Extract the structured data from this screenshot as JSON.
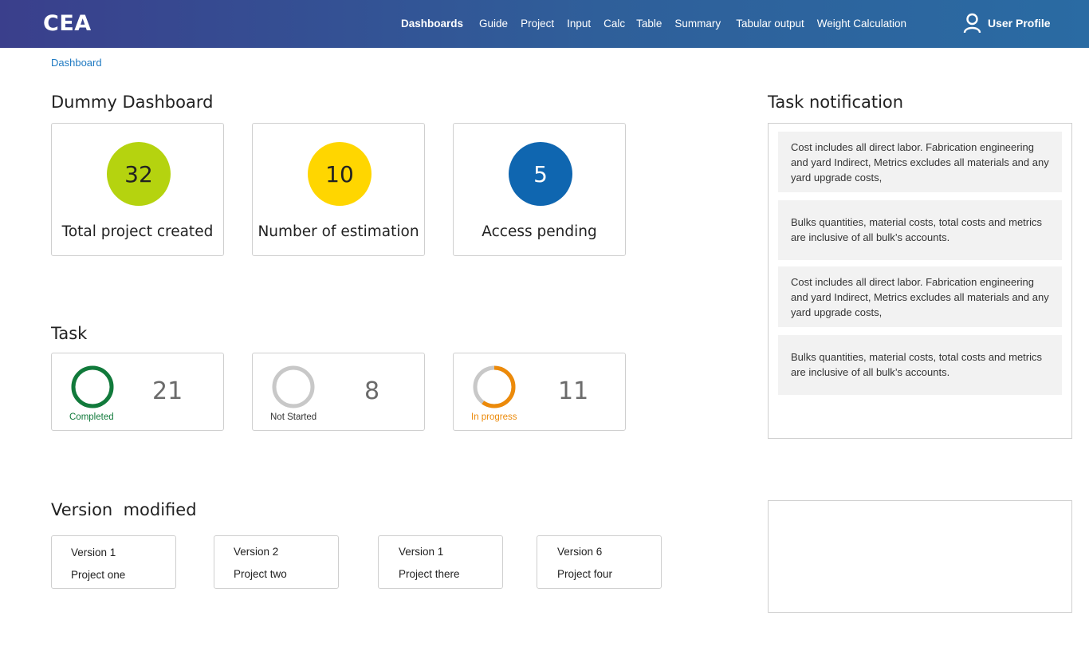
{
  "header": {
    "logo": "CEA",
    "nav": [
      "Dashboards",
      "Guide",
      "Project",
      "Input",
      "Calc",
      "Table",
      "Summary",
      "Tabular output",
      "Weight Calculation"
    ],
    "profile_label": "User Profile"
  },
  "breadcrumb": "Dashboard",
  "dashboard": {
    "title": "Dummy Dashboard",
    "stats": [
      {
        "value": "32",
        "label": "Total project created",
        "color": "#b5d30f"
      },
      {
        "value": "10",
        "label": "Number of estimation",
        "color": "#ffd600"
      },
      {
        "value": "5",
        "label": "Access pending",
        "color": "#0f66b0"
      }
    ]
  },
  "task": {
    "title": "Task",
    "items": [
      {
        "label": "Completed",
        "count": "21",
        "color": "#117a3b",
        "progress": 1.0
      },
      {
        "label": "Not Started",
        "count": "8",
        "color": "#c8c8c8",
        "progress": 0.0
      },
      {
        "label": "In progress",
        "count": "11",
        "color": "#ec8a0a",
        "progress": 0.6
      }
    ]
  },
  "versions": {
    "title": "Version  modified",
    "items": [
      {
        "version": "Version 1",
        "project": "Project one"
      },
      {
        "version": "Version 2",
        "project": "Project two"
      },
      {
        "version": "Version 1",
        "project": "Project there"
      },
      {
        "version": "Version 6",
        "project": "Project four"
      }
    ]
  },
  "notifications": {
    "title": "Task notification",
    "items": [
      "Cost includes all direct labor. Fabrication engineering and yard Indirect, Metrics excludes all materials and any yard upgrade costs,",
      "Bulks quantities, material costs, total costs and metrics are inclusive of all bulk’s accounts.",
      "Cost includes all direct labor. Fabrication engineering and yard Indirect, Metrics excludes all materials and any yard upgrade costs,",
      "Bulks quantities, material costs, total costs and metrics are inclusive of all bulk’s accounts."
    ]
  }
}
